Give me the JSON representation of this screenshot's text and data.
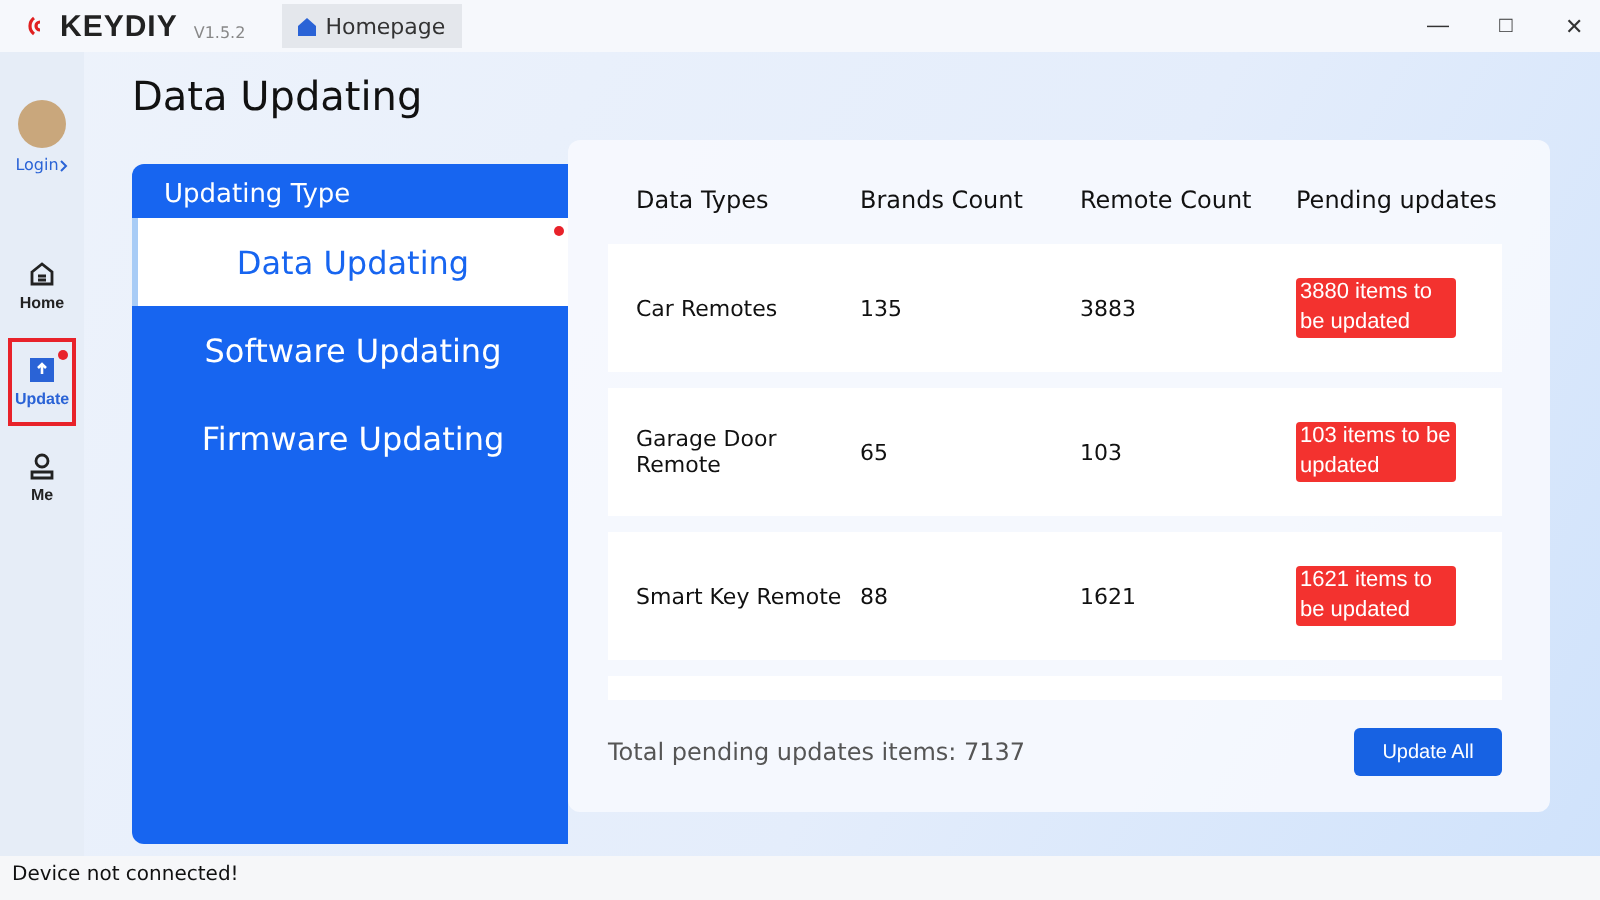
{
  "titlebar": {
    "brand": "KEYDIY",
    "version": "V1.5.2",
    "tab": "Homepage",
    "controls": [
      "—",
      "□",
      "✕"
    ]
  },
  "sidebar": {
    "login": "Login",
    "items": [
      {
        "kind": "home",
        "label": "Home",
        "selected": false,
        "badge": false,
        "highlighted": false
      },
      {
        "kind": "update",
        "label": "Update",
        "selected": true,
        "badge": true,
        "highlighted": true
      },
      {
        "kind": "me",
        "label": "Me",
        "selected": false,
        "badge": false,
        "highlighted": false
      }
    ]
  },
  "page_title": "Data Updating",
  "type_panel": {
    "heading": "Updating Type",
    "items": [
      {
        "label": "Data Updating",
        "selected": true,
        "badge": true
      },
      {
        "label": "Software Updating",
        "selected": false,
        "badge": false
      },
      {
        "label": "Firmware Updating",
        "selected": false,
        "badge": false
      }
    ]
  },
  "table": {
    "columns": [
      "Data Types",
      "Brands Count",
      "Remote Count",
      "Pending updates"
    ],
    "rows": [
      {
        "type": "Car Remotes",
        "brands": "135",
        "remotes": "3883",
        "pending": "3880 items to be updated"
      },
      {
        "type": "Garage Door Remote",
        "brands": "65",
        "remotes": "103",
        "pending": "103 items to be updated"
      },
      {
        "type": "Smart Key Remote",
        "brands": "88",
        "remotes": "1621",
        "pending": "1621 items to be updated"
      }
    ]
  },
  "total": "Total pending updates items: 7137",
  "update_all": "Update All",
  "status_bar": "Device not connected!"
}
